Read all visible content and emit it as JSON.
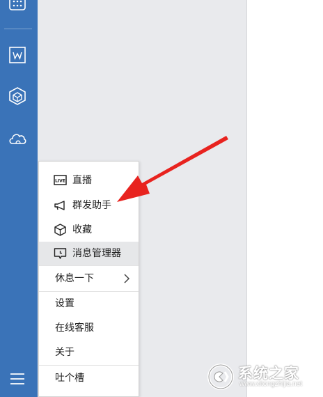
{
  "sidebar": {
    "icons": [
      "apps-grid-icon",
      "word-doc-icon",
      "cube-hexagon-icon",
      "cloud-icon",
      "hamburger-menu-icon"
    ],
    "color": "#3a73b8"
  },
  "menu": {
    "items": [
      {
        "label": "直播",
        "icon": "live-icon"
      },
      {
        "label": "群发助手",
        "icon": "megaphone-icon"
      },
      {
        "label": "收藏",
        "icon": "box-icon"
      },
      {
        "label": "消息管理器",
        "icon": "message-manager-icon",
        "active": true
      },
      {
        "label": "休息一下",
        "has_submenu": true
      },
      {
        "label": "设置"
      },
      {
        "label": "在线客服"
      },
      {
        "label": "关于"
      },
      {
        "label": "吐个槽"
      }
    ]
  },
  "annotation": {
    "arrow_color": "#e8231f"
  },
  "watermark": {
    "title": "系统之家",
    "url": "www.xitongzhijia.net"
  }
}
